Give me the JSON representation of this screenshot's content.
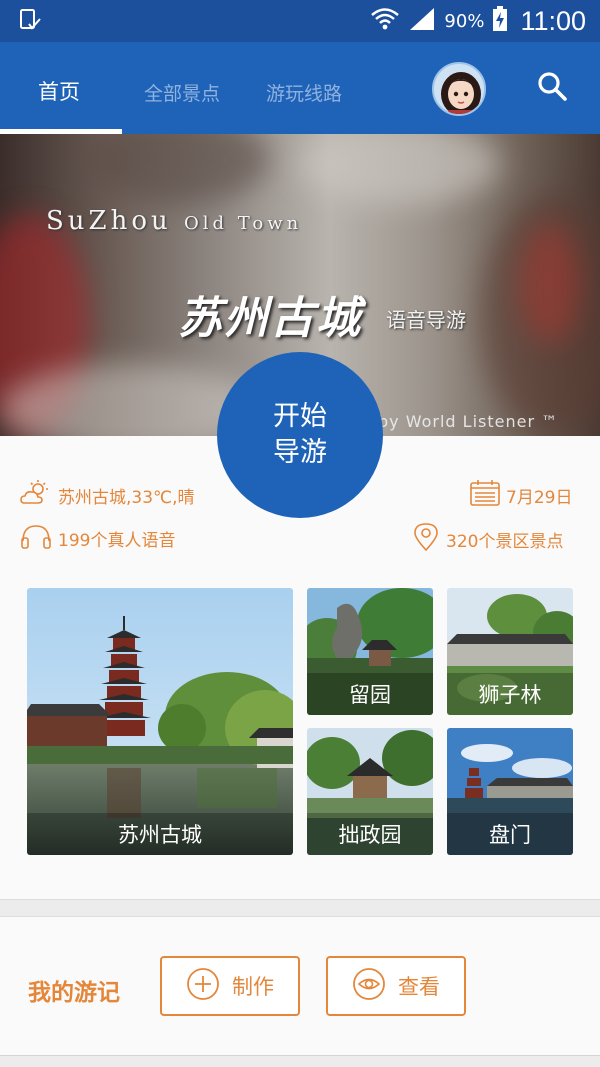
{
  "status_bar": {
    "battery": "90%",
    "time": "11:00"
  },
  "app_bar": {
    "tabs": [
      {
        "label": "首页",
        "active": true
      },
      {
        "label": "全部景点",
        "active": false
      },
      {
        "label": "游玩线路",
        "active": false
      }
    ]
  },
  "banner": {
    "title_en_1": "SuZhou",
    "title_en_2": "Old Town",
    "title_cn": "苏州古城",
    "subtitle": "语音导游",
    "credit": "by World Listener ™"
  },
  "start_button": {
    "line1": "开始",
    "line2": "导游"
  },
  "info": {
    "weather": "苏州古城,33℃,晴",
    "date": "7月29日",
    "voices": "199个真人语音",
    "spots": "320个景区景点"
  },
  "tiles": [
    {
      "label": "苏州古城"
    },
    {
      "label": "留园"
    },
    {
      "label": "狮子林"
    },
    {
      "label": "拙政园"
    },
    {
      "label": "盘门"
    }
  ],
  "travelogue": {
    "title": "我的游记",
    "create_label": "制作",
    "view_label": "查看"
  },
  "colors": {
    "primary": "#1e63b8",
    "status_bar": "#1c4f9c",
    "accent": "#e4873b"
  }
}
